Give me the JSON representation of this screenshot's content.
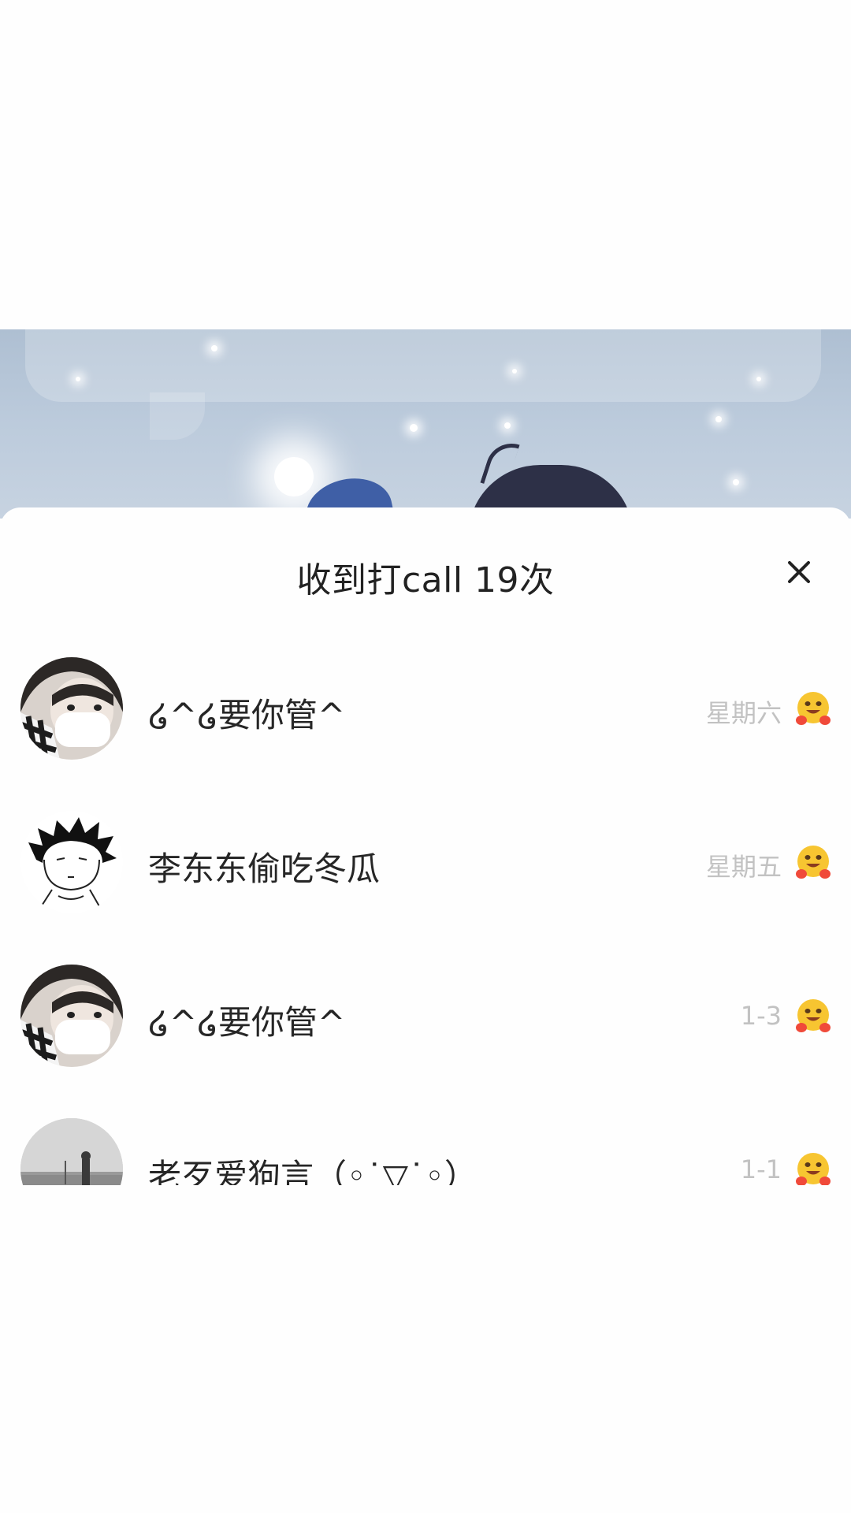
{
  "sheet": {
    "title": "收到打call 19次",
    "close_icon": "close-icon"
  },
  "rows": [
    {
      "name": "໒^໒要你管^",
      "date": "星期六",
      "avatar_icon": "avatar-girl-mask-icon",
      "reaction_icon": "hugging-face-emoji-icon"
    },
    {
      "name": "李东东偷吃冬瓜",
      "date": "星期五",
      "avatar_icon": "avatar-sketch-boy-icon",
      "reaction_icon": "hugging-face-emoji-icon"
    },
    {
      "name": "໒^໒要你管^",
      "date": "1-3",
      "avatar_icon": "avatar-girl-mask-icon",
      "reaction_icon": "hugging-face-emoji-icon"
    },
    {
      "name": "老歹爱狗言（◦˙▽˙◦）",
      "date": "1-1",
      "avatar_icon": "avatar-beach-photo-icon",
      "reaction_icon": "hugging-face-emoji-icon"
    }
  ],
  "colors": {
    "sheet_bg": "#fefefe",
    "title_text": "#222222",
    "name_text": "#262626",
    "date_text": "#c2c2c2",
    "emoji_yellow": "#f7c531"
  }
}
